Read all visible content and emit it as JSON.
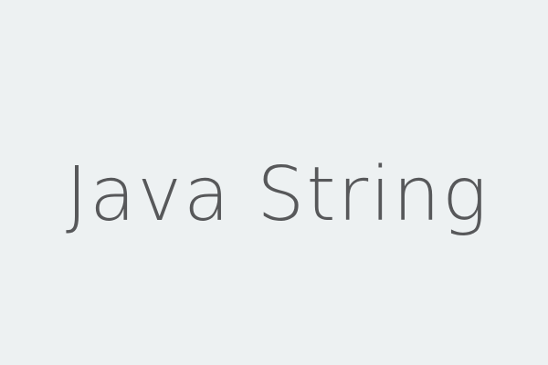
{
  "main": {
    "title": "Java String"
  },
  "colors": {
    "background": "#EDF1F2",
    "text": "#57585A"
  }
}
